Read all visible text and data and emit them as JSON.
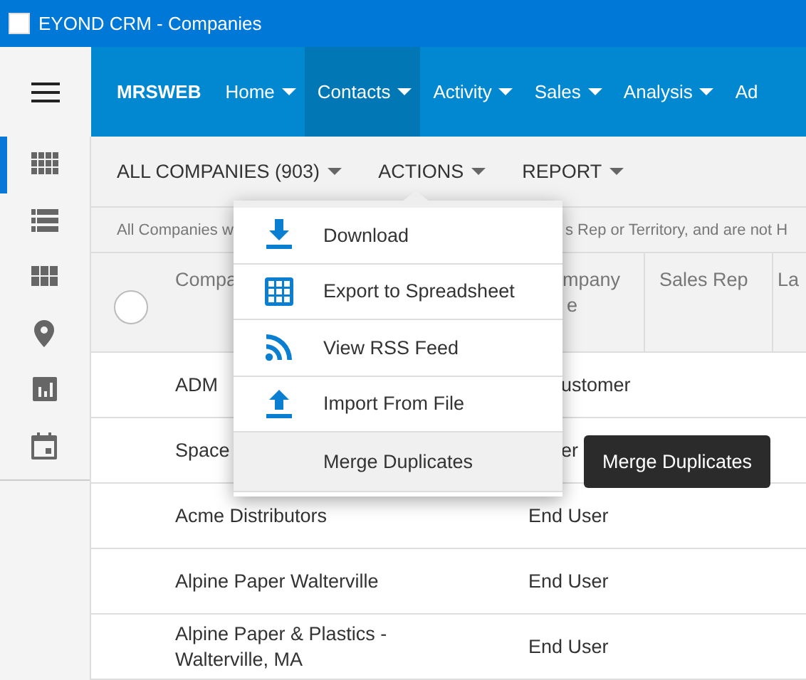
{
  "window": {
    "title": "EYOND CRM - Companies"
  },
  "nav": {
    "brand": "MRSWEB",
    "items": [
      {
        "label": "Home",
        "selected": false
      },
      {
        "label": "Contacts",
        "selected": true
      },
      {
        "label": "Activity",
        "selected": false
      },
      {
        "label": "Sales",
        "selected": false
      },
      {
        "label": "Analysis",
        "selected": false
      },
      {
        "label": "Ad",
        "selected": false
      }
    ]
  },
  "sidebar": {
    "items": [
      {
        "kind": "grid",
        "selected": true
      },
      {
        "kind": "list",
        "selected": false
      },
      {
        "kind": "tiles",
        "selected": false
      },
      {
        "kind": "pin",
        "selected": false
      },
      {
        "kind": "chart",
        "selected": false
      },
      {
        "kind": "calendar",
        "selected": false
      }
    ]
  },
  "toolbar": [
    {
      "label": "ALL COMPANIES (903)"
    },
    {
      "label": "ACTIONS"
    },
    {
      "label": "REPORT"
    }
  ],
  "info": {
    "left": "All Companies w",
    "right": "s Rep or Territory, and are not H"
  },
  "table": {
    "select_all": {
      "checked": false
    },
    "columns": [
      {
        "lines": [
          "Compa"
        ],
        "cut": false
      },
      {
        "lines": [
          "mpany",
          "e"
        ],
        "cut": true
      },
      {
        "lines": [
          "Sales Rep"
        ],
        "cut": false
      },
      {
        "lines": [
          "La"
        ],
        "cut": false
      }
    ],
    "rows": [
      {
        "name": "ADM",
        "type": "ustomer",
        "type_cut": true
      },
      {
        "name": "Space",
        "type": "er",
        "type_cut": true
      },
      {
        "name": "Acme Distributors",
        "type": "End User",
        "type_cut": false
      },
      {
        "name": "Alpine Paper Walterville",
        "type": "End User",
        "type_cut": false
      },
      {
        "name": "Alpine Paper & Plastics - Walterville, MA",
        "type": "End User",
        "type_cut": false
      }
    ]
  },
  "menu": {
    "items": [
      {
        "label": "Download",
        "kind": "download",
        "highlighted": false
      },
      {
        "label": "Export to Spreadsheet",
        "kind": "grid",
        "highlighted": false
      },
      {
        "label": "View RSS Feed",
        "kind": "rss",
        "highlighted": false
      },
      {
        "label": "Import From File",
        "kind": "upload",
        "highlighted": false
      },
      {
        "label": "Merge Duplicates",
        "kind": "plain",
        "highlighted": true
      }
    ]
  },
  "tooltip": "Merge Duplicates"
}
